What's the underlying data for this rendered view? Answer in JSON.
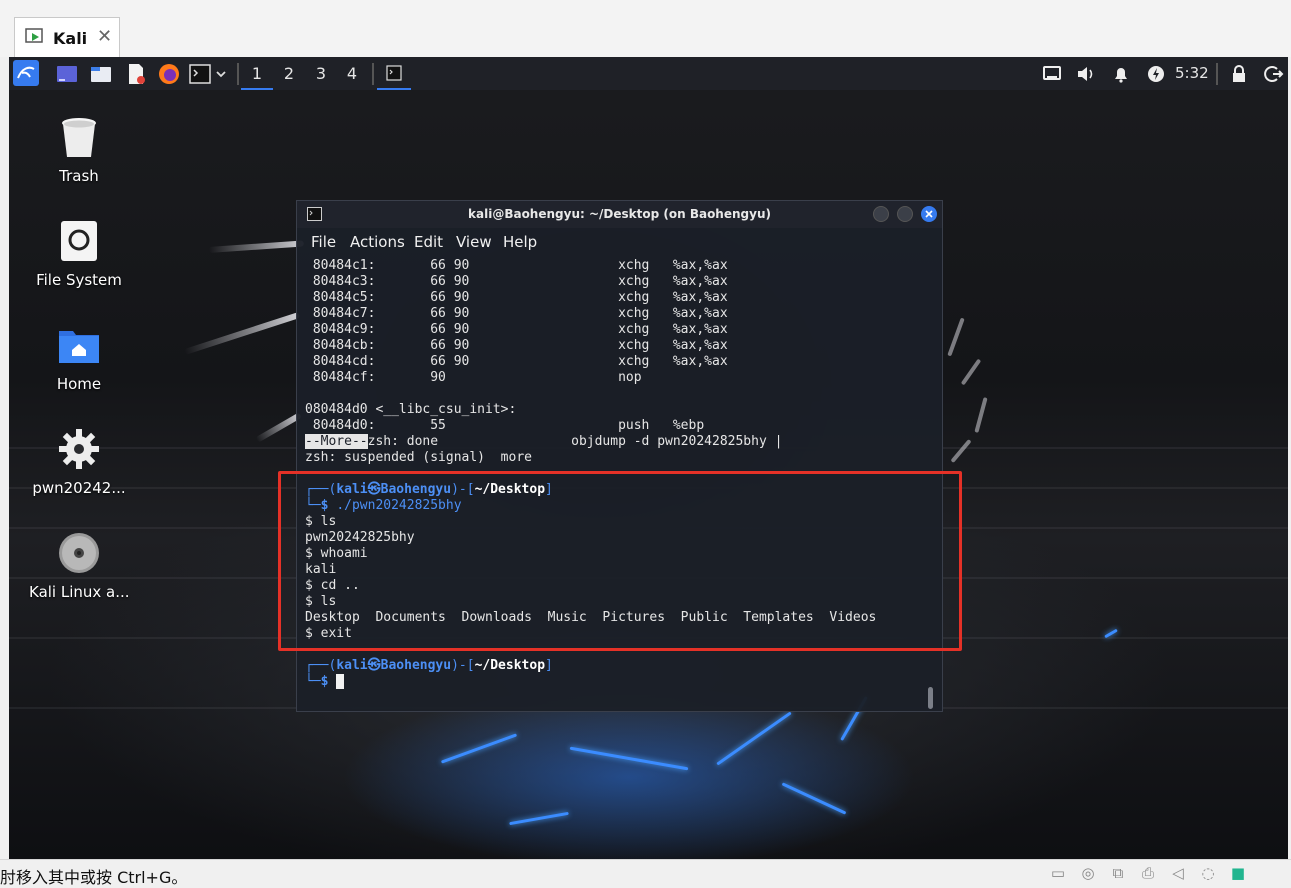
{
  "host": {
    "tab_label": "Kali",
    "tab_close": "✕",
    "status_text": "肘移入其中或按 Ctrl+G。"
  },
  "panel": {
    "workspaces": [
      "1",
      "2",
      "3",
      "4"
    ],
    "active_workspace": "1",
    "clock": "5:32",
    "accent_color": "#367bf0"
  },
  "desktop_icons": [
    {
      "label": "Trash",
      "icon": "trash-icon"
    },
    {
      "label": "File System",
      "icon": "drive-icon"
    },
    {
      "label": "Home",
      "icon": "home-folder-icon"
    },
    {
      "label": "pwn20242...",
      "icon": "gear-file-icon"
    },
    {
      "label": "Kali Linux a...",
      "icon": "disc-icon"
    }
  ],
  "terminal": {
    "title": "kali@Baohengyu: ~/Desktop (on Baohengyu)",
    "menu": [
      "File",
      "Actions",
      "Edit",
      "View",
      "Help"
    ],
    "lines": [
      " 80484c1:       66 90                   xchg   %ax,%ax",
      " 80484c3:       66 90                   xchg   %ax,%ax",
      " 80484c5:       66 90                   xchg   %ax,%ax",
      " 80484c7:       66 90                   xchg   %ax,%ax",
      " 80484c9:       66 90                   xchg   %ax,%ax",
      " 80484cb:       66 90                   xchg   %ax,%ax",
      " 80484cd:       66 90                   xchg   %ax,%ax",
      " 80484cf:       90                      nop",
      "",
      "080484d0 <__libc_csu_init>:",
      " 80484d0:       55                      push   %ebp"
    ],
    "more_marker": "--More--",
    "more_rest": "zsh: done                 objdump -d pwn20242825bhy |",
    "suspended_line": "zsh: suspended (signal)  more",
    "prompt1": {
      "user": "kali",
      "at_symbol": "㉿",
      "host": "Baohengyu",
      "path": "~/Desktop",
      "command": "./pwn20242825bhy"
    },
    "session_lines": [
      "$ ls",
      "pwn20242825bhy",
      "$ whoami",
      "kali",
      "$ cd ..",
      "$ ls",
      "Desktop  Documents  Downloads  Music  Pictures  Public  Templates  Videos",
      "$ exit"
    ],
    "prompt2": {
      "user": "kali",
      "at_symbol": "㉿",
      "host": "Baohengyu",
      "path": "~/Desktop",
      "command": ""
    }
  },
  "highlight_color": "#e53127"
}
